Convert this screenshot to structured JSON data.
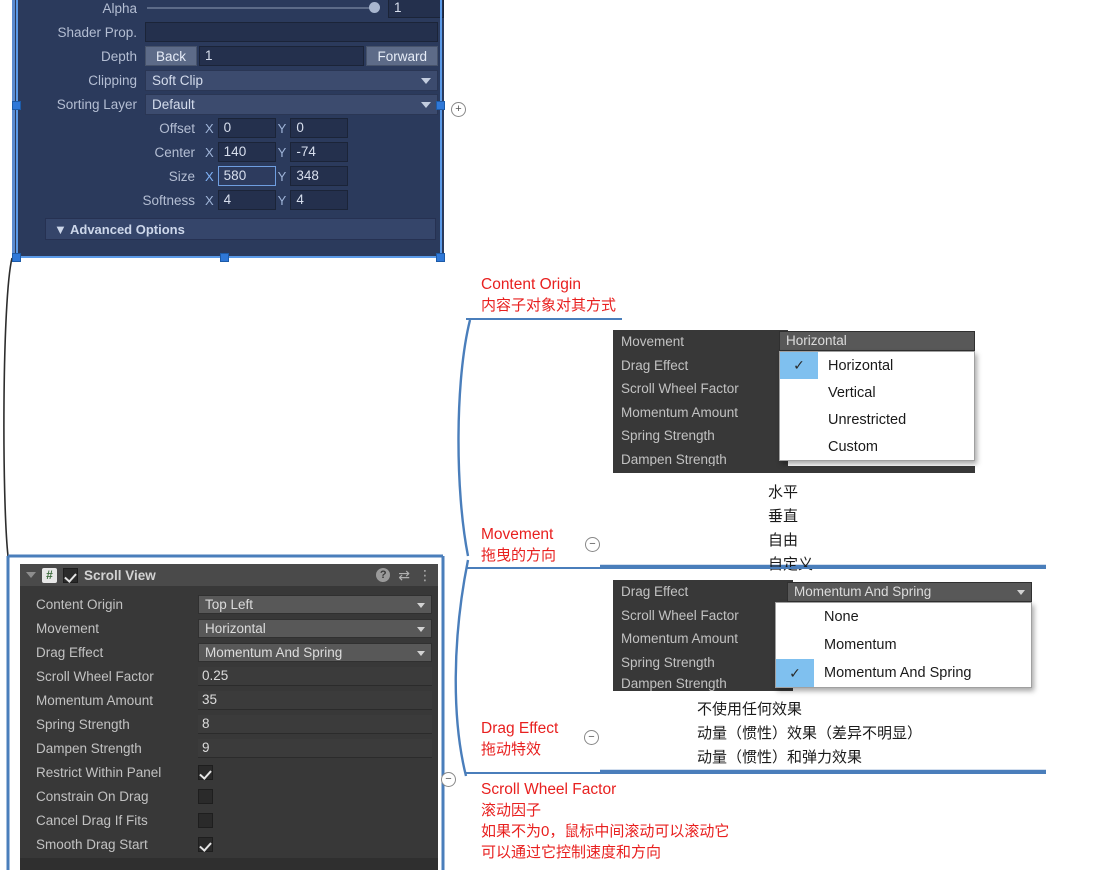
{
  "ngui_panel": {
    "name": "ngui-ui-panel-inspector",
    "rows": [
      {
        "label": "Alpha",
        "type": "slider",
        "value": "1"
      },
      {
        "label": "Shader Prop.",
        "type": "text",
        "value": ""
      },
      {
        "label": "Depth",
        "type": "depth",
        "back": "Back",
        "value": "1",
        "forward": "Forward"
      },
      {
        "label": "Clipping",
        "type": "dropdown",
        "value": "Soft Clip"
      },
      {
        "label": "Sorting Layer",
        "type": "dropdown",
        "value": "Default"
      },
      {
        "label": "Offset",
        "type": "xy",
        "x_label": "X",
        "x": "0",
        "y_label": "Y",
        "y": "0",
        "indent": true
      },
      {
        "label": "Center",
        "type": "xy",
        "x_label": "X",
        "x": "140",
        "y_label": "Y",
        "y": "-74",
        "indent": true
      },
      {
        "label": "Size",
        "type": "xy",
        "x_label": "X",
        "x": "580",
        "y_label": "Y",
        "y": "348",
        "indent": true,
        "x_focused": true
      },
      {
        "label": "Softness",
        "type": "xy",
        "x_label": "X",
        "x": "4",
        "y_label": "Y",
        "y": "4",
        "indent": true
      }
    ],
    "advanced_options": "▼ Advanced Options"
  },
  "scroll_view": {
    "header": {
      "title": "Scroll View",
      "script_glyph": "#",
      "enabled": true,
      "help_glyph": "?",
      "preset_glyph": "⇄",
      "menu_glyph": "⋮"
    },
    "rows": [
      {
        "label": "Content Origin",
        "type": "dropdown",
        "value": "Top Left"
      },
      {
        "label": "Movement",
        "type": "dropdown",
        "value": "Horizontal"
      },
      {
        "label": "Drag Effect",
        "type": "dropdown",
        "value": "Momentum And Spring"
      },
      {
        "label": "Scroll Wheel Factor",
        "type": "input",
        "value": "0.25"
      },
      {
        "label": "Momentum Amount",
        "type": "input",
        "value": "35"
      },
      {
        "label": "Spring Strength",
        "type": "input",
        "value": "8"
      },
      {
        "label": "Dampen Strength",
        "type": "input",
        "value": "9"
      },
      {
        "label": "Restrict Within Panel",
        "type": "check",
        "checked": true
      },
      {
        "label": "Constrain On Drag",
        "type": "check",
        "checked": false
      },
      {
        "label": "Cancel Drag If Fits",
        "type": "check",
        "checked": false
      },
      {
        "label": "Smooth Drag Start",
        "type": "check",
        "checked": true
      }
    ]
  },
  "movement_popup": {
    "backdrop_labels": [
      "Movement",
      "Drag Effect",
      "Scroll Wheel Factor",
      "Momentum Amount",
      "Spring Strength",
      "Dampen Strength"
    ],
    "current_value": "Horizontal",
    "options": [
      {
        "label": "Horizontal",
        "selected": true
      },
      {
        "label": "Vertical",
        "selected": false
      },
      {
        "label": "Unrestricted",
        "selected": false
      },
      {
        "label": "Custom",
        "selected": false
      }
    ],
    "translations": [
      "水平",
      "垂直",
      "自由",
      "自定义"
    ]
  },
  "drag_effect_popup": {
    "backdrop_labels": [
      "Drag Effect",
      "Scroll Wheel Factor",
      "Momentum Amount",
      "Spring Strength",
      "Dampen Strength"
    ],
    "current_value": "Momentum And Spring",
    "options": [
      {
        "label": "None",
        "selected": false
      },
      {
        "label": "Momentum",
        "selected": false
      },
      {
        "label": "Momentum And Spring",
        "selected": true
      }
    ],
    "translations": [
      "不使用任何效果",
      "动量（惯性）效果（差异不明显）",
      "动量（惯性）和弹力效果"
    ]
  },
  "annotations": {
    "content_origin": {
      "en": "Content Origin",
      "cn": "内容子对象对其方式"
    },
    "movement": {
      "en": "Movement",
      "cn": "拖曳的方向"
    },
    "drag_effect": {
      "en": "Drag Effect",
      "cn": "拖动特效"
    },
    "scroll_wheel_factor": {
      "en": "Scroll Wheel Factor",
      "cn1": "滚动因子",
      "cn2": "如果不为0，鼠标中间滚动可以滚动它",
      "cn3": "可以通过它控制速度和方向"
    }
  },
  "node_toggles": {
    "expand": "+",
    "collapse": "−"
  },
  "colors": {
    "annotation_red": "#e8201f",
    "underline_blue": "#4a7ebb",
    "ngui_panel_bg": "#2b3a5c",
    "unity_panel_bg": "#383838",
    "popup_highlight": "#7fc0ef",
    "selection_blue": "#2f78d8"
  }
}
